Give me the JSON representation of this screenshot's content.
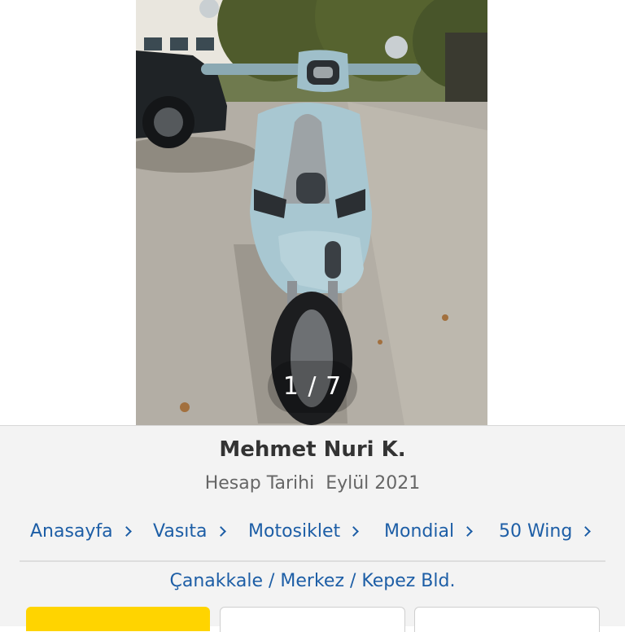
{
  "gallery": {
    "counter": "1 / 7"
  },
  "seller": {
    "name": "Mehmet Nuri K.",
    "account_label": "Hesap Tarihi",
    "account_date": "Eylül 2021"
  },
  "breadcrumb": [
    {
      "label": "Anasayfa"
    },
    {
      "label": "Vasıta"
    },
    {
      "label": "Motosiklet"
    },
    {
      "label": "Mondial"
    },
    {
      "label": "50 Wing"
    }
  ],
  "location": "Çanakkale / Merkez / Kepez Bld.",
  "colors": {
    "link": "#1d5ea6",
    "accent": "#ffd400",
    "panel": "#f3f3f3"
  }
}
